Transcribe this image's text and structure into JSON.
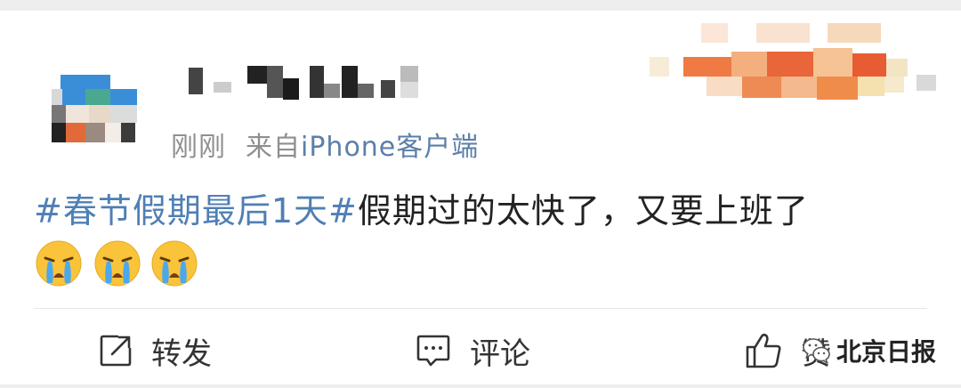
{
  "post": {
    "timestamp": "刚刚",
    "source_prefix": "来自",
    "source_device": "iPhone客户端",
    "hashtag": "#春节假期最后1天#",
    "body_text": "假期过的太快了，又要上班了",
    "emojis": [
      "crying-face",
      "crying-face",
      "crying-face"
    ]
  },
  "actions": {
    "repost_label": "转发",
    "comment_label": "评论",
    "like_label": "赞"
  },
  "watermark": {
    "text": "北京日报"
  },
  "colors": {
    "hashtag": "#4f7fb5",
    "meta": "#8f8f8f",
    "text": "#222222"
  }
}
